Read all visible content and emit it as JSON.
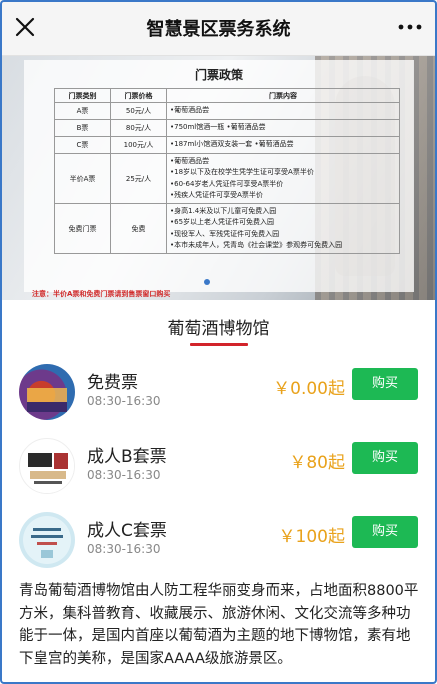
{
  "nav": {
    "title": "智慧景区票务系统",
    "close_icon": "close-icon",
    "more_icon": "more-dots-icon"
  },
  "policy": {
    "title": "门票政策",
    "headers": [
      "门票类别",
      "门票价格",
      "门票内容"
    ],
    "rows": [
      {
        "category": "A票",
        "price": "50元/人",
        "content": [
          "•葡萄酒品尝"
        ]
      },
      {
        "category": "B票",
        "price": "80元/人",
        "content": [
          "•750ml馆酒一瓶 •葡萄酒品尝"
        ]
      },
      {
        "category": "C票",
        "price": "100元/人",
        "content": [
          "•187ml小馆酒双支装一套 •葡萄酒品尝"
        ]
      },
      {
        "category": "半价A票",
        "price": "25元/人",
        "content": [
          "•葡萄酒品尝",
          "•18岁以下及在校学生凭学生证可享受A票半价",
          "•60-64岁老人凭证件可享受A票半价",
          "•残疾人凭证件可享受A票半价"
        ]
      },
      {
        "category": "免费门票",
        "price": "免费",
        "content": [
          "•身高1.4米及以下儿童可免费入园",
          "•65岁以上老人凭证件可免费入园",
          "•现役军人、军残凭证件可免费入园",
          "•本市未成年人，凭青岛《社会课堂》参观券可免费入园"
        ]
      }
    ],
    "note": "注意：半价A票和免费门票请到售票窗口购买"
  },
  "venue": {
    "name": "葡萄酒博物馆"
  },
  "tickets": [
    {
      "name": "免费票",
      "time": "08:30-16:30",
      "price": "￥0.00起",
      "button": "购买"
    },
    {
      "name": "成人B套票",
      "time": "08:30-16:30",
      "price": "￥80起",
      "button": "购买"
    },
    {
      "name": "成人C套票",
      "time": "08:30-16:30",
      "price": "￥100起",
      "button": "购买"
    }
  ],
  "description": "青岛葡萄酒博物馆由人防工程华丽变身而来，占地面积8800平方米，集科普教育、收藏展示、旅游休闲、文化交流等多种功能于一体，是国内首座以葡萄酒为主题的地下博物馆，素有地下皇宫的美称，是国家AAAA级旅游景区。",
  "colors": {
    "accent_red": "#d2232a",
    "buy_green": "#1db954",
    "price_orange": "#e9a21b",
    "note_red": "#d12a2a"
  }
}
